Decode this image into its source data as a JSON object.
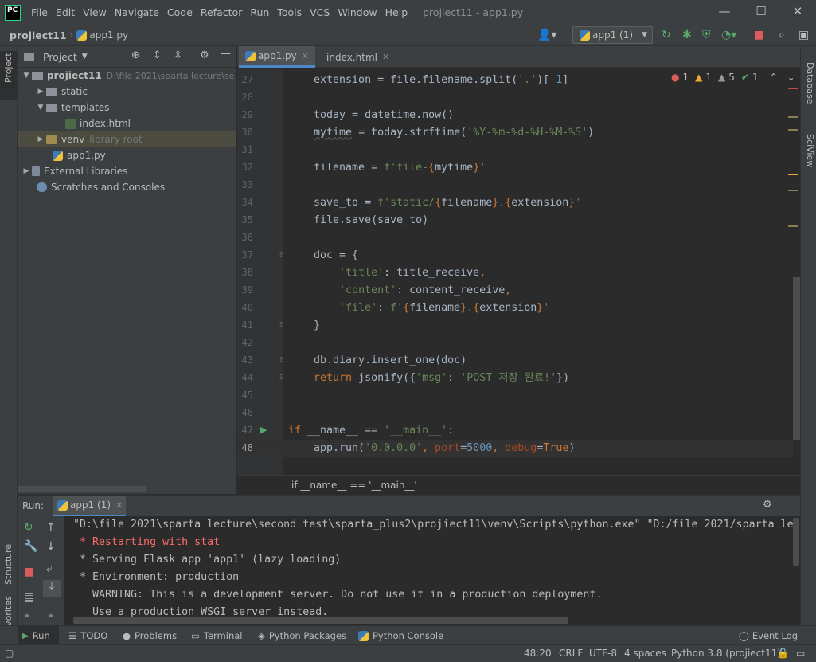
{
  "window": {
    "logo": "PC",
    "title": "projiect11 - app1.py",
    "menu": [
      "File",
      "Edit",
      "View",
      "Navigate",
      "Code",
      "Refactor",
      "Run",
      "Tools",
      "VCS",
      "Window",
      "Help"
    ],
    "minimize": "—",
    "maximize": "☐",
    "close": "✕"
  },
  "navbar": {
    "project": "projiect11",
    "file": "app1.py",
    "run_config": "app1 (1)"
  },
  "left_stripe": {
    "project": "Project",
    "structure": "Structure",
    "favorites": "Favorites"
  },
  "right_stripe": {
    "database": "Database",
    "sciview": "SciView"
  },
  "project_panel": {
    "title": "Project",
    "tree": [
      {
        "label": "projiect11",
        "note": "D:\\file 2021\\sparta lecture\\se",
        "type": "root"
      },
      {
        "label": "static",
        "type": "folder"
      },
      {
        "label": "templates",
        "type": "folder"
      },
      {
        "label": "index.html",
        "type": "html"
      },
      {
        "label": "venv",
        "note": "library root",
        "type": "venv"
      },
      {
        "label": "app1.py",
        "type": "py"
      },
      {
        "label": "External Libraries",
        "type": "lib"
      },
      {
        "label": "Scratches and Consoles",
        "type": "scratch"
      }
    ]
  },
  "editor": {
    "tabs": [
      {
        "label": "app1.py",
        "active": true
      },
      {
        "label": "index.html",
        "active": false
      }
    ],
    "inspections": {
      "errors": "1",
      "warnings": "1",
      "weak": "5",
      "typos": "1"
    },
    "line_numbers": [
      "27",
      "28",
      "29",
      "30",
      "31",
      "32",
      "33",
      "34",
      "35",
      "36",
      "37",
      "38",
      "39",
      "40",
      "41",
      "42",
      "43",
      "44",
      "45",
      "46",
      "47",
      "48"
    ],
    "breadcrumb": "if __name__ == '__main__'"
  },
  "run": {
    "label": "Run:",
    "tab": "app1 (1)",
    "console": [
      "\"D:\\file 2021\\sparta lecture\\second test\\sparta_plus2\\projiect11\\venv\\Scripts\\python.exe\" \"D:/file 2021/sparta lec",
      " * Restarting with stat",
      " * Serving Flask app 'app1' (lazy loading)",
      " * Environment: production",
      "   WARNING: This is a development server. Do not use it in a production deployment.",
      "   Use a production WSGI server instead."
    ]
  },
  "tool_tabs": [
    "Run",
    "TODO",
    "Problems",
    "Terminal",
    "Python Packages",
    "Python Console"
  ],
  "event_log": "Event Log",
  "status": {
    "position": "48:20",
    "line_sep": "CRLF",
    "encoding": "UTF-8",
    "indent": "4 spaces",
    "interpreter": "Python 3.8 (projiect11)"
  },
  "colors": {
    "accent": "#4a88c7",
    "bg": "#2b2b2b",
    "panel": "#3c3f41",
    "keyword": "#cc7832",
    "string": "#6a8759",
    "number": "#6897bb",
    "error": "#ff6b68"
  }
}
